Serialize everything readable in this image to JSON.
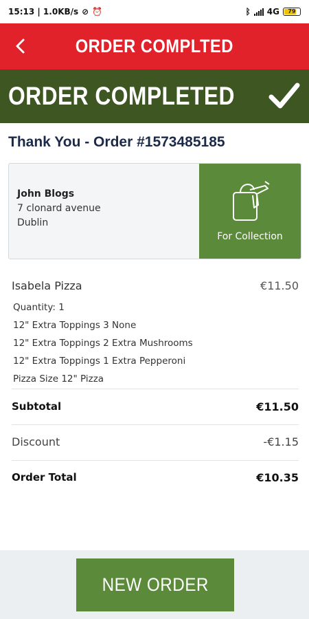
{
  "status_bar": {
    "time_info": "15:13 | 1.0KB/s",
    "network": "4G",
    "battery": "79"
  },
  "app_bar": {
    "title": "ORDER COMPLTED"
  },
  "banner": {
    "title": "ORDER COMPLETED"
  },
  "thanks": "Thank You - Order #1573485185",
  "customer": {
    "name": "John Blogs",
    "address_line1": "7 clonard avenue",
    "city": "Dublin"
  },
  "fulfillment": {
    "label": "For Collection"
  },
  "item": {
    "name": "Isabela Pizza",
    "price": "€11.50",
    "details": [
      "Quantity: 1",
      "12\" Extra Toppings 3 None",
      "12\" Extra Toppings 2 Extra Mushrooms",
      "12\" Extra Toppings 1 Extra Pepperoni",
      "Pizza Size 12\" Pizza"
    ]
  },
  "summary": {
    "subtotal_label": "Subtotal",
    "subtotal_value": "€11.50",
    "discount_label": "Discount",
    "discount_value": "-€1.15",
    "total_label": "Order Total",
    "total_value": "€10.35"
  },
  "footer": {
    "new_order_label": "NEW ORDER"
  },
  "colors": {
    "app_bar": "#e1222b",
    "banner": "#3e5722",
    "accent_green": "#5a8a3a",
    "heading_navy": "#1c2a4a"
  }
}
